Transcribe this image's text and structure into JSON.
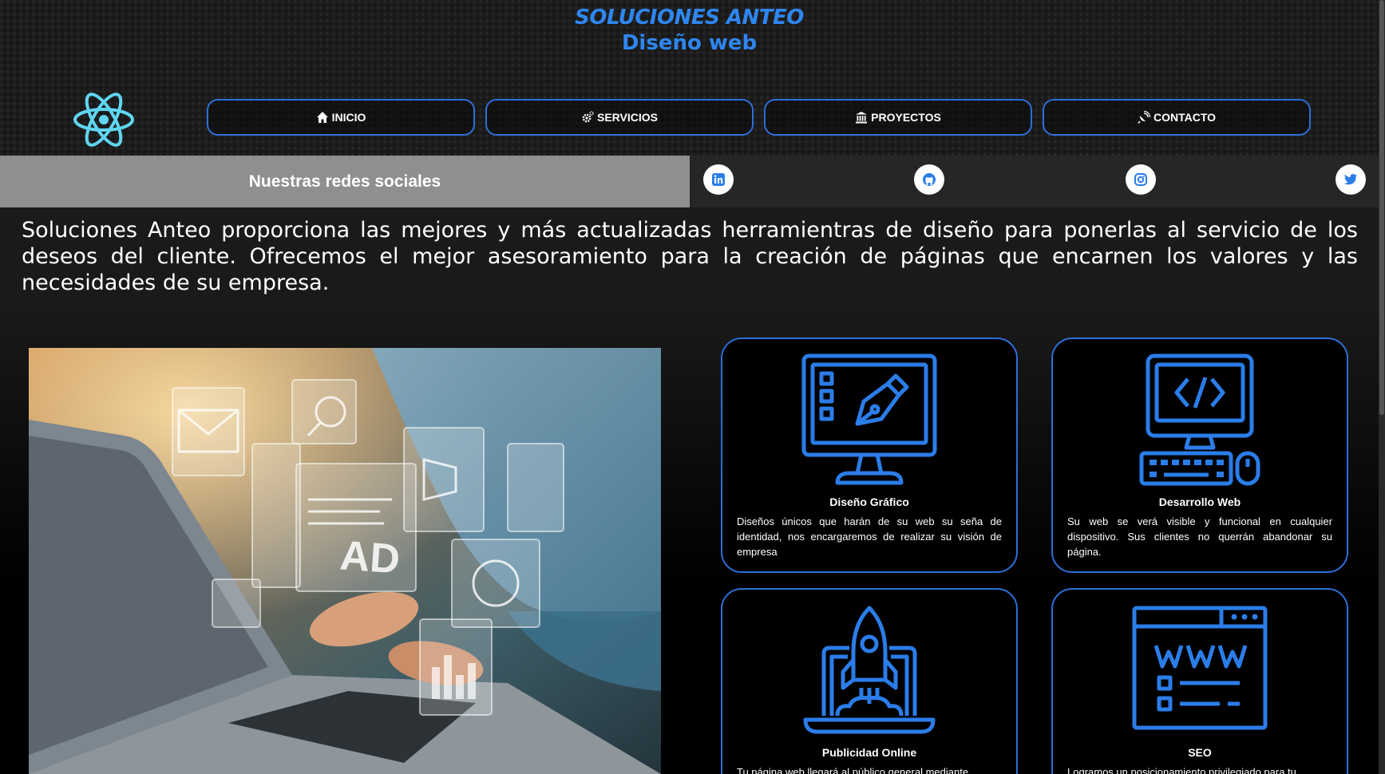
{
  "brand": {
    "title": "SOLUCIONES ANTEO",
    "subtitle": "Diseño web",
    "logo_icon": "react-atom-icon"
  },
  "nav": [
    {
      "label": "INICIO",
      "icon": "home-icon"
    },
    {
      "label": "SERVICIOS",
      "icon": "gears-icon"
    },
    {
      "label": "PROYECTOS",
      "icon": "bank-icon"
    },
    {
      "label": "CONTACTO",
      "icon": "satellite-dish-icon"
    }
  ],
  "social": {
    "title": "Nuestras redes sociales",
    "icons": [
      "linkedin-icon",
      "github-icon",
      "instagram-icon",
      "twitter-icon"
    ]
  },
  "intro": "Soluciones Anteo proporciona las mejores y más actualizadas herramientras de diseño para ponerlas al servicio de los deseos del cliente. Ofrecemos el mejor asesoramiento para la creación de páginas que encarnen los valores y las necesidades de su empresa.",
  "hero": {
    "image": "laptop-digital-marketing-photo",
    "overlay_text": "AD"
  },
  "services": [
    {
      "title": "Diseño Gráfico",
      "desc": "Diseños únicos que harán de su web su seña de identidad, nos encargaremos de realizar su visión de empresa",
      "icon": "graphic-design-monitor-icon"
    },
    {
      "title": "Desarrollo Web",
      "desc": "Su web se verá visible y funcional en cualquier dispositivo. Sus clientes no querrán abandonar su página.",
      "icon": "code-computer-icon"
    },
    {
      "title": "Publicidad Online",
      "desc": "Tu página web llegará al público general mediante",
      "icon": "rocket-laptop-icon"
    },
    {
      "title": "SEO",
      "desc": "Logramos un posicionamiento privilegiado para tu",
      "icon": "www-browser-icon"
    }
  ],
  "colors": {
    "accent": "#2e86f0",
    "border": "#2c6fd9",
    "social_title_bg": "#8f8f91",
    "icon_blue": "#2b7de9"
  }
}
